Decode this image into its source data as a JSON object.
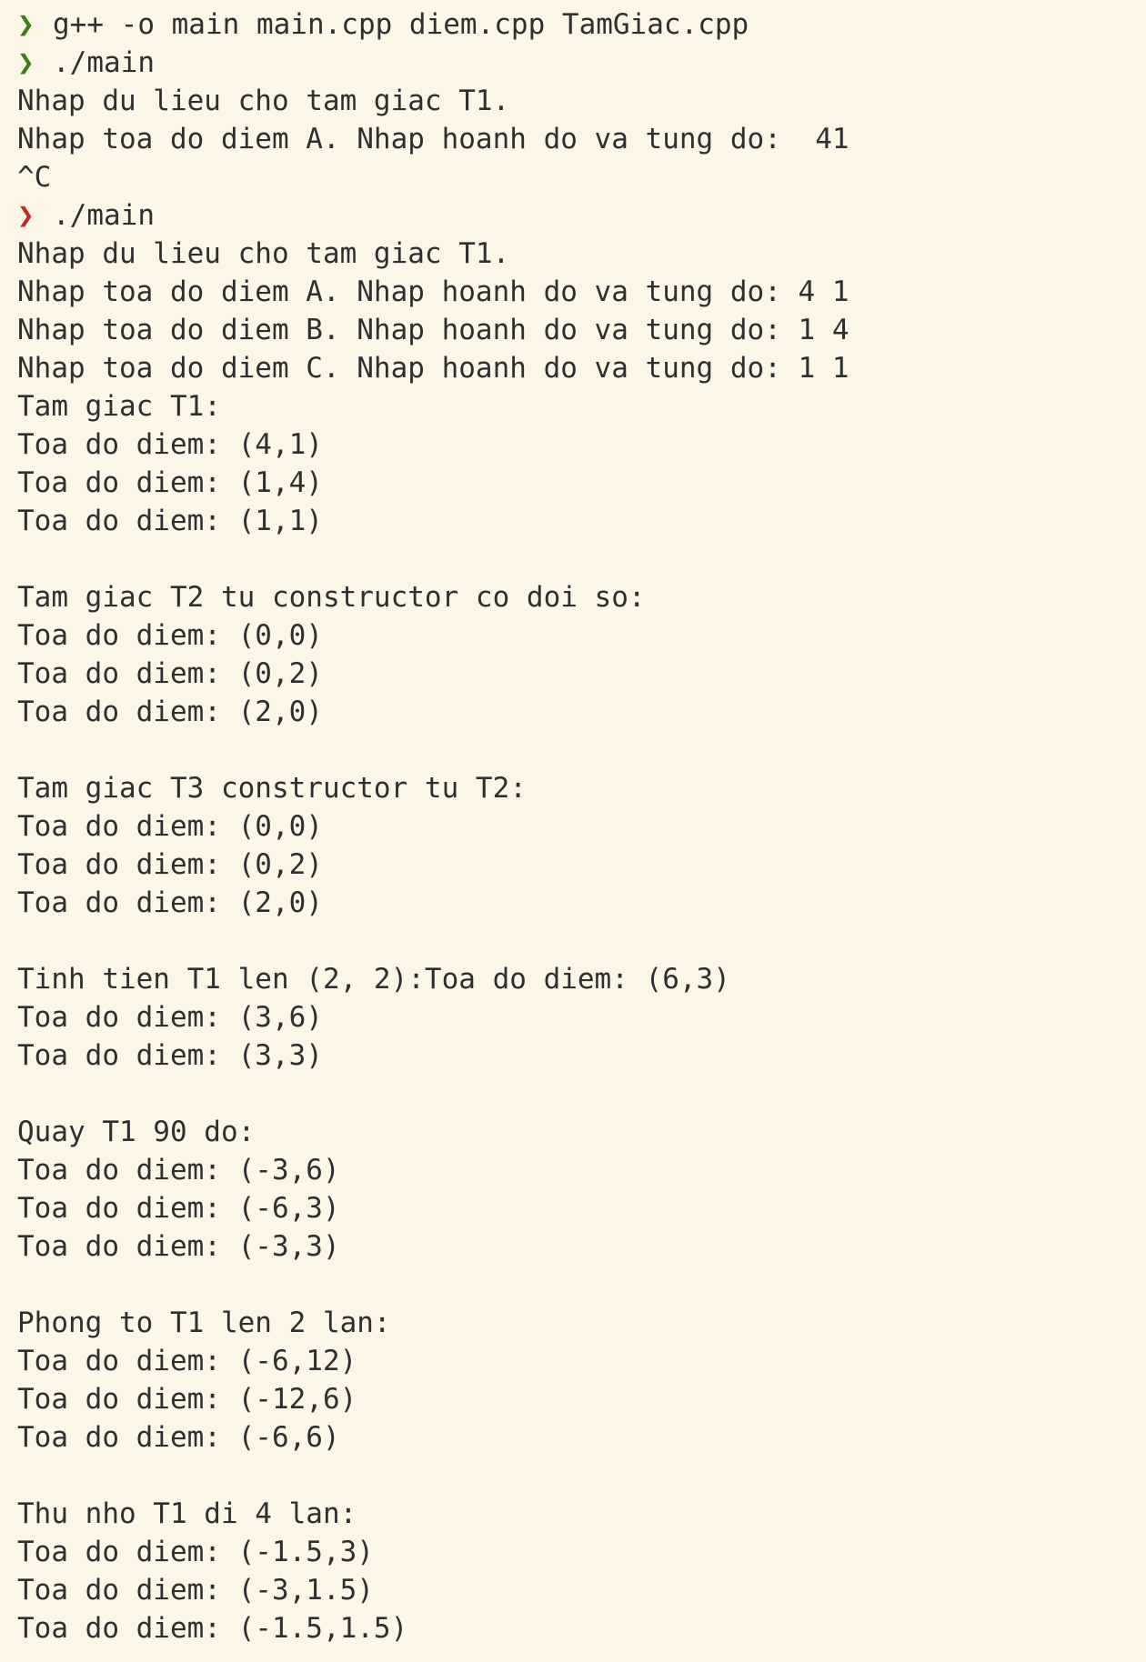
{
  "terminal": {
    "colors": {
      "background": "#fcf6e6",
      "text": "#2f2f2f",
      "prompt_success": "#3a7d19",
      "prompt_error": "#c02a21"
    },
    "prompt_glyph": "❯",
    "lines": [
      {
        "kind": "cmd",
        "status": "ok",
        "text": "g++ -o main main.cpp diem.cpp TamGiac.cpp"
      },
      {
        "kind": "cmd",
        "status": "ok",
        "text": "./main"
      },
      {
        "kind": "out",
        "text": "Nhap du lieu cho tam giac T1."
      },
      {
        "kind": "out",
        "text": "Nhap toa do diem A. Nhap hoanh do va tung do:  41"
      },
      {
        "kind": "out",
        "text": "^C"
      },
      {
        "kind": "cmd",
        "status": "err",
        "text": "./main"
      },
      {
        "kind": "out",
        "text": "Nhap du lieu cho tam giac T1."
      },
      {
        "kind": "out",
        "text": "Nhap toa do diem A. Nhap hoanh do va tung do: 4 1"
      },
      {
        "kind": "out",
        "text": "Nhap toa do diem B. Nhap hoanh do va tung do: 1 4"
      },
      {
        "kind": "out",
        "text": "Nhap toa do diem C. Nhap hoanh do va tung do: 1 1"
      },
      {
        "kind": "out",
        "text": "Tam giac T1:"
      },
      {
        "kind": "out",
        "text": "Toa do diem: (4,1)"
      },
      {
        "kind": "out",
        "text": "Toa do diem: (1,4)"
      },
      {
        "kind": "out",
        "text": "Toa do diem: (1,1)"
      },
      {
        "kind": "blank"
      },
      {
        "kind": "out",
        "text": "Tam giac T2 tu constructor co doi so:"
      },
      {
        "kind": "out",
        "text": "Toa do diem: (0,0)"
      },
      {
        "kind": "out",
        "text": "Toa do diem: (0,2)"
      },
      {
        "kind": "out",
        "text": "Toa do diem: (2,0)"
      },
      {
        "kind": "blank"
      },
      {
        "kind": "out",
        "text": "Tam giac T3 constructor tu T2:"
      },
      {
        "kind": "out",
        "text": "Toa do diem: (0,0)"
      },
      {
        "kind": "out",
        "text": "Toa do diem: (0,2)"
      },
      {
        "kind": "out",
        "text": "Toa do diem: (2,0)"
      },
      {
        "kind": "blank"
      },
      {
        "kind": "out",
        "text": "Tinh tien T1 len (2, 2):Toa do diem: (6,3)"
      },
      {
        "kind": "out",
        "text": "Toa do diem: (3,6)"
      },
      {
        "kind": "out",
        "text": "Toa do diem: (3,3)"
      },
      {
        "kind": "blank"
      },
      {
        "kind": "out",
        "text": "Quay T1 90 do:"
      },
      {
        "kind": "out",
        "text": "Toa do diem: (-3,6)"
      },
      {
        "kind": "out",
        "text": "Toa do diem: (-6,3)"
      },
      {
        "kind": "out",
        "text": "Toa do diem: (-3,3)"
      },
      {
        "kind": "blank"
      },
      {
        "kind": "out",
        "text": "Phong to T1 len 2 lan:"
      },
      {
        "kind": "out",
        "text": "Toa do diem: (-6,12)"
      },
      {
        "kind": "out",
        "text": "Toa do diem: (-12,6)"
      },
      {
        "kind": "out",
        "text": "Toa do diem: (-6,6)"
      },
      {
        "kind": "blank"
      },
      {
        "kind": "out",
        "text": "Thu nho T1 di 4 lan:"
      },
      {
        "kind": "out",
        "text": "Toa do diem: (-1.5,3)"
      },
      {
        "kind": "out",
        "text": "Toa do diem: (-3,1.5)"
      },
      {
        "kind": "out",
        "text": "Toa do diem: (-1.5,1.5)"
      }
    ]
  }
}
